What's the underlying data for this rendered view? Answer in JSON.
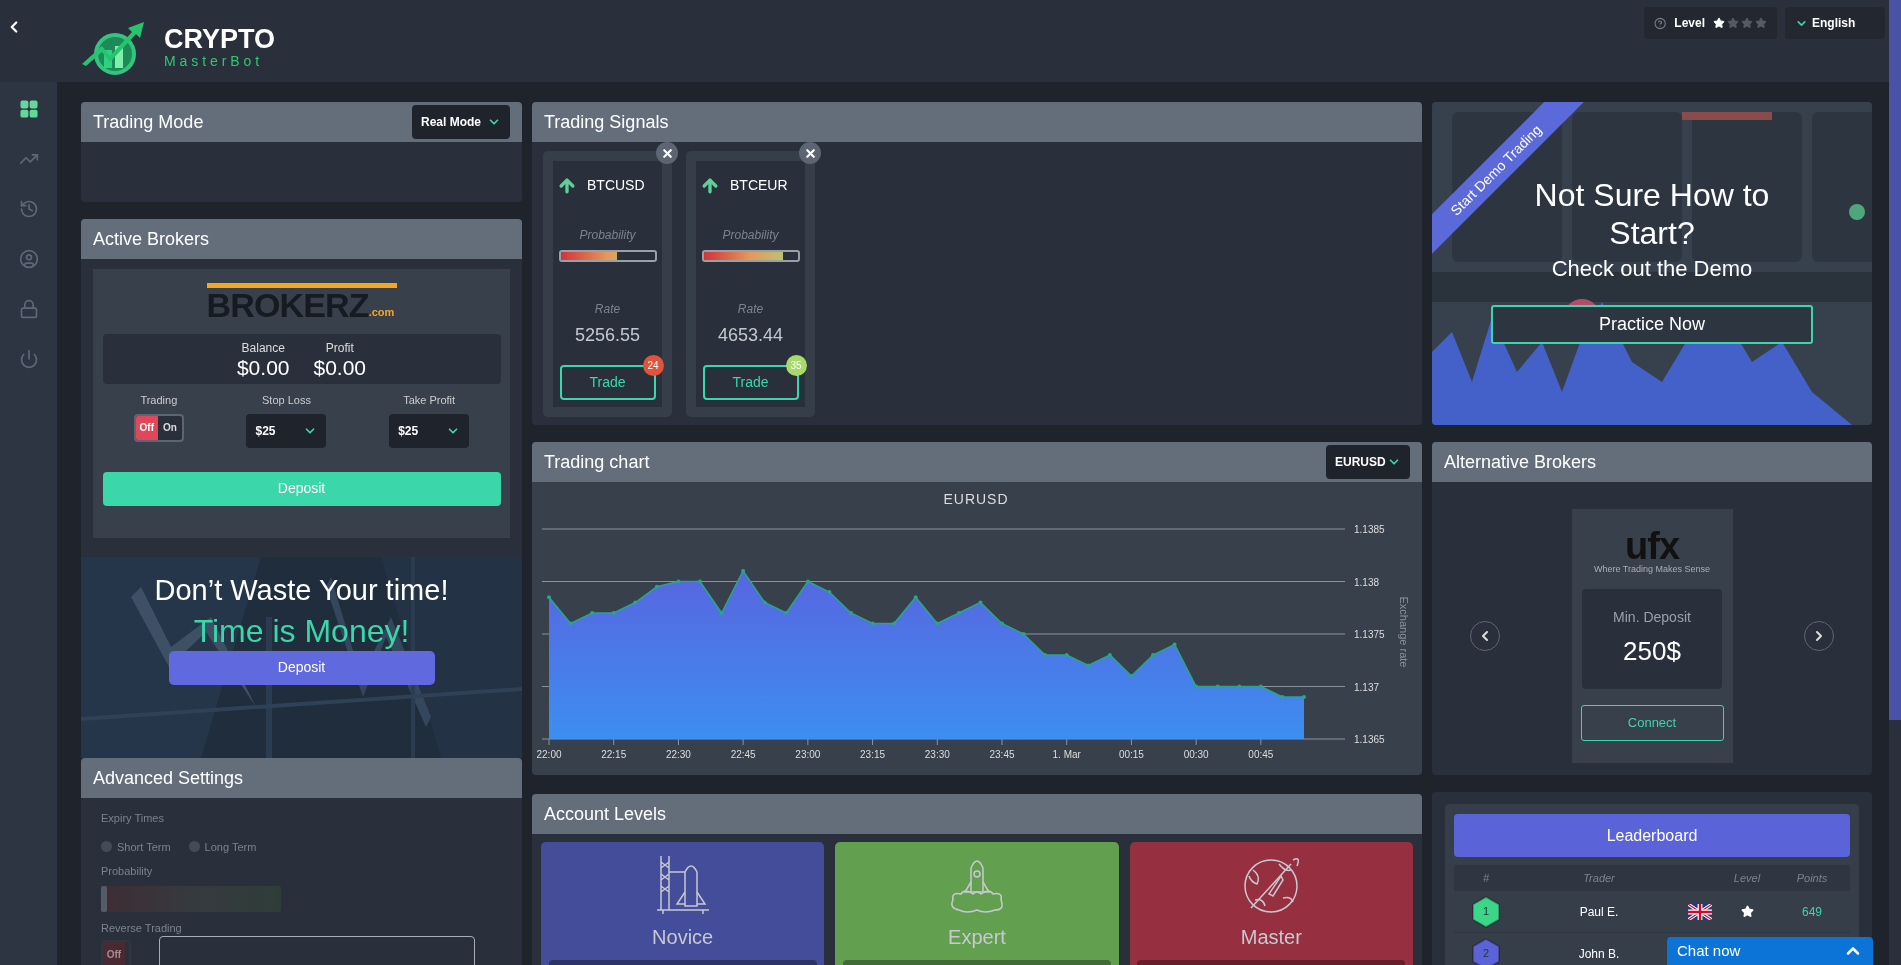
{
  "sidebar": {
    "items": [
      {
        "kind": "grid",
        "selected": true
      },
      {
        "kind": "chart",
        "selected": false
      },
      {
        "kind": "history",
        "selected": false
      },
      {
        "kind": "user",
        "selected": false
      },
      {
        "kind": "lock",
        "selected": false
      },
      {
        "kind": "power",
        "selected": false
      }
    ]
  },
  "logo": {
    "title": "CRYPTO",
    "subtitle": "MasterBot"
  },
  "top_bar": {
    "level": {
      "label": "Level",
      "stars": 1
    },
    "language": "English"
  },
  "trading_mode": {
    "title": "Trading Mode",
    "mode": "Real Mode"
  },
  "active_brokers": {
    "title": "Active Brokers",
    "broker_logo": {
      "name": "BROKERZ",
      "suffix": ".com"
    },
    "balance": {
      "label": "Balance",
      "value": "$0.00"
    },
    "profit": {
      "label": "Profit",
      "value": "$0.00"
    },
    "trading": {
      "label": "Trading",
      "off": "Off",
      "on_label": "On",
      "on": false
    },
    "stop_loss": {
      "label": "Stop Loss",
      "value": "$25"
    },
    "take_profit": {
      "label": "Take Profit",
      "value": "$25"
    },
    "button": "Deposit"
  },
  "promo": {
    "headline": "Don’t Waste Your time!",
    "tagline": "Time is Money!",
    "button": "Deposit"
  },
  "advanced_settings": {
    "title": "Advanced Settings",
    "disabled": true,
    "expiry_label": "Expiry Times",
    "expiry_options": [
      {
        "label": "Short Term",
        "selected": false
      },
      {
        "label": "Long Term",
        "selected": false
      }
    ],
    "probability_label": "Probability",
    "probability": {
      "level": 0
    },
    "reverse_label": "Reverse Trading",
    "reverse": {
      "off": "Off",
      "on": false
    }
  },
  "trading_signals": {
    "title": "Trading Signals",
    "cards": [
      {
        "pair": "BTCUSD",
        "probability_label": "Probability",
        "level": 0.6,
        "rate_label": "Rate",
        "rate": "5256.55",
        "button": "Trade",
        "badge": "24",
        "color": "#e0533d"
      },
      {
        "pair": "BTCEUR",
        "probability_label": "Probability",
        "level": 0.85,
        "rate_label": "Rate",
        "rate": "4653.44",
        "button": "Trade",
        "badge": "35",
        "color": "#a8d96b"
      }
    ]
  },
  "trading_chart": {
    "title": "Trading chart",
    "symbol": "EURUSD",
    "chart_data": {
      "type": "area",
      "title": "EURUSD",
      "ylabel": "Exchange rate",
      "categories": [
        "22:00",
        null,
        null,
        "22:15",
        null,
        null,
        "22:30",
        null,
        null,
        "22:45",
        null,
        null,
        "23:00",
        null,
        null,
        "23:15",
        null,
        null,
        "23:30",
        null,
        null,
        "23:45",
        null,
        null,
        "1. Mar",
        null,
        null,
        "00:15",
        null,
        null,
        "00:30",
        null,
        null,
        "00:45",
        null,
        null
      ],
      "series": [
        {
          "color": "#5865e0",
          "values": [
            1.13785,
            1.1376,
            1.1377,
            1.1377,
            1.1378,
            1.13795,
            1.138,
            1.138,
            1.1377,
            1.1381,
            1.1378,
            1.1377,
            1.138,
            1.1379,
            1.1377,
            1.1376,
            1.1376,
            1.13785,
            1.1376,
            1.1377,
            1.1378,
            1.1376,
            1.1375,
            1.1373,
            1.1373,
            1.1372,
            1.1373,
            1.1371,
            1.1373,
            1.1374,
            1.137,
            1.137,
            1.137,
            1.137,
            1.1369,
            1.1369
          ]
        }
      ],
      "grid": true,
      "ylim": [
        1.1365,
        1.1385
      ],
      "yticks": [
        1.1365,
        1.137,
        1.1375,
        1.138,
        1.1385
      ]
    }
  },
  "demo": {
    "ribbon": "Start Demo Trading",
    "headline": "Not Sure How to Start?",
    "subline": "Check out the Demo",
    "button": "Practice Now"
  },
  "alternative_brokers": {
    "title": "Alternative Brokers",
    "broker": {
      "logo": "ufx",
      "logo_tagline": "Where Trading Makes Sense",
      "min_deposit_label": "Min. Deposit",
      "min_deposit": "250$",
      "button": "Connect"
    }
  },
  "account_levels": {
    "title": "Account Levels",
    "levels": [
      {
        "name": "Novice",
        "kind": "launchpad",
        "color": "#434d9a"
      },
      {
        "name": "Expert",
        "kind": "launch",
        "color": "#62a050"
      },
      {
        "name": "Master",
        "kind": "planet",
        "color": "#963040"
      }
    ]
  },
  "leaderboard": {
    "button": "Leaderboard",
    "columns": [
      "#",
      "Trader",
      "Level",
      "Points"
    ],
    "rows": [
      {
        "rank": "1",
        "color": "#3bd68a",
        "trader": "Paul E.",
        "points": "649"
      },
      {
        "rank": "2",
        "color": "#5b63d8",
        "trader": "John B."
      }
    ]
  },
  "chat": {
    "label": "Chat now"
  }
}
